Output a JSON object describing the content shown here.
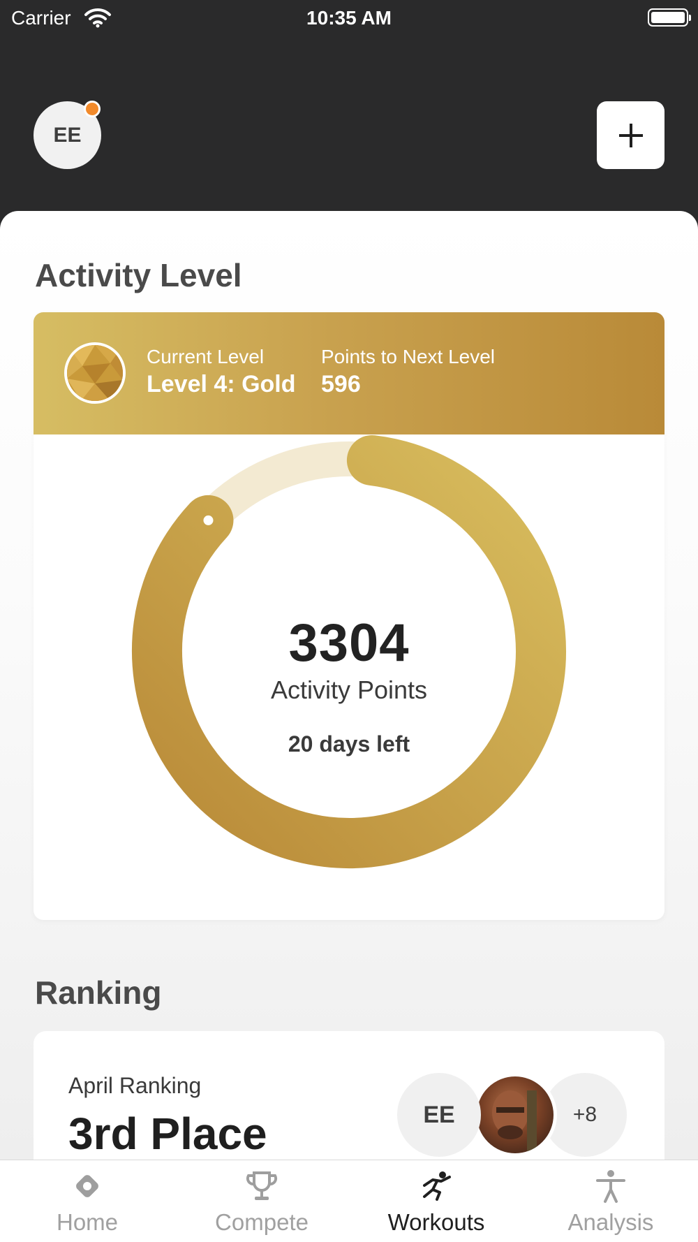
{
  "status_bar": {
    "carrier": "Carrier",
    "time": "10:35 AM"
  },
  "header": {
    "avatar_initials": "EE",
    "add_icon": "plus-icon"
  },
  "activity": {
    "section_title": "Activity Level",
    "current_level_label": "Current Level",
    "current_level_value": "Level 4: Gold",
    "next_level_label": "Points to Next Level",
    "next_level_value": "596",
    "points_value": "3304",
    "points_label": "Activity Points",
    "days_left": "20 days left",
    "progress_fraction": 0.85,
    "colors": {
      "gold_light": "#d8bd5e",
      "gold_dark": "#b98a38",
      "track": "#f3ead2"
    }
  },
  "ranking": {
    "section_title": "Ranking",
    "month_label": "April Ranking",
    "place": "3rd Place",
    "avatar_initials": "EE",
    "more_count": "+8"
  },
  "tabs": [
    {
      "label": "Home",
      "icon": "home-icon",
      "active": false
    },
    {
      "label": "Compete",
      "icon": "trophy-icon",
      "active": false
    },
    {
      "label": "Workouts",
      "icon": "workout-runner-icon",
      "active": true
    },
    {
      "label": "Analysis",
      "icon": "person-icon",
      "active": false
    }
  ]
}
